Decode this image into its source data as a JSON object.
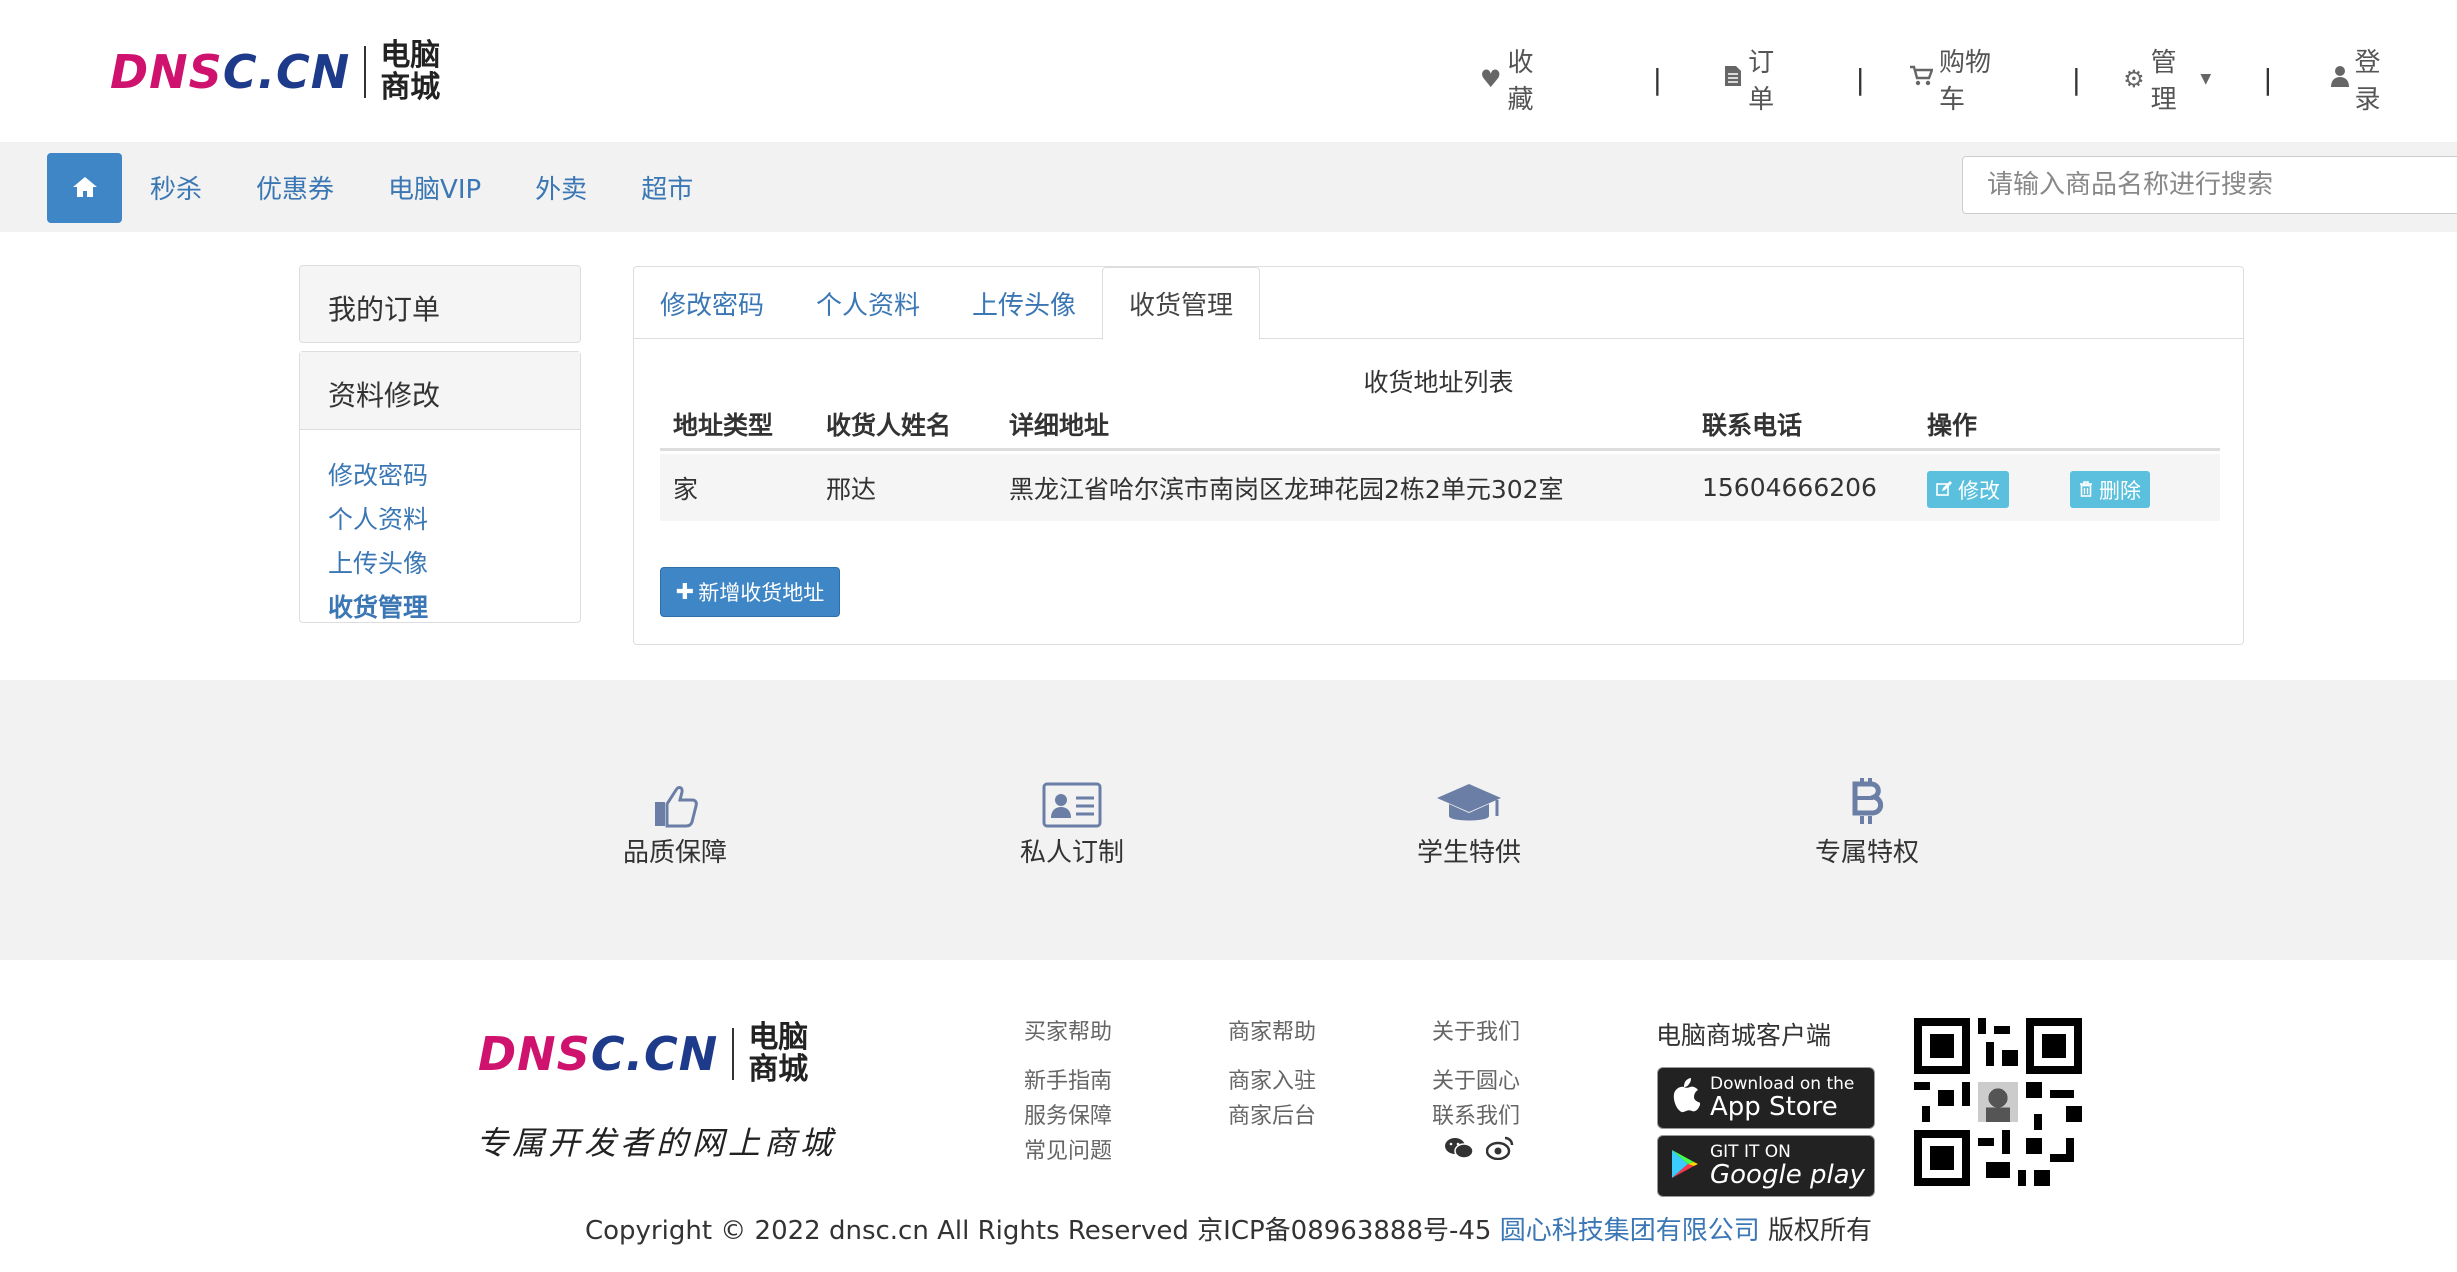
{
  "brand": {
    "logo_en": "DNSC.CN",
    "logo_cn_line1": "电脑",
    "logo_cn_line2": "商城",
    "colors": {
      "magenta": "#d0126f",
      "navy": "#1e3a8a",
      "primary": "#3f86c6",
      "info": "#5bc0de",
      "link": "#3a77b4"
    }
  },
  "topnav": {
    "favorites": "收藏",
    "orders": "订单",
    "cart": "购物车",
    "manage": "管理",
    "login": "登录",
    "separator": "|"
  },
  "navbar": {
    "home_icon": "home-icon",
    "links": [
      "秒杀",
      "优惠券",
      "电脑VIP",
      "外卖",
      "超市"
    ],
    "search_placeholder": "请输入商品名称进行搜索"
  },
  "sidebar": {
    "my_orders": "我的订单",
    "profile_edit": "资料修改",
    "links": [
      "修改密码",
      "个人资料",
      "上传头像",
      "收货管理"
    ],
    "active_index": 3
  },
  "main": {
    "tabs": [
      "修改密码",
      "个人资料",
      "上传头像",
      "收货管理"
    ],
    "active_tab": 3,
    "table_caption": "收货地址列表",
    "columns": [
      "地址类型",
      "收货人姓名",
      "详细地址",
      "联系电话",
      "操作"
    ],
    "rows": [
      {
        "type": "家",
        "name": "邢达",
        "address": "黑龙江省哈尔滨市南岗区龙珅花园2栋2单元302室",
        "phone": "15604666206",
        "edit": "修改",
        "delete": "删除"
      }
    ],
    "add_button": "新增收货地址"
  },
  "features": [
    {
      "label": "品质保障",
      "icon": "thumbs-up-icon"
    },
    {
      "label": "私人订制",
      "icon": "id-card-icon"
    },
    {
      "label": "学生特供",
      "icon": "graduation-cap-icon"
    },
    {
      "label": "专属特权",
      "icon": "bitcoin-icon"
    }
  ],
  "footer": {
    "slogan": "专属开发者的网上商城",
    "buyer_help": {
      "title": "买家帮助",
      "links": [
        "新手指南",
        "服务保障",
        "常见问题"
      ]
    },
    "merchant_help": {
      "title": "商家帮助",
      "links": [
        "商家入驻",
        "商家后台"
      ]
    },
    "about": {
      "title": "关于我们",
      "links": [
        "关于圆心",
        "联系我们"
      ]
    },
    "client_title": "电脑商城客户端",
    "app_store_small": "Download on the",
    "app_store_big": "App Store",
    "google_small": "GIT IT ON",
    "google_big": "Google play",
    "copyright_prefix": "Copyright © 2022 dnsc.cn All Rights Reserved 京ICP备08963888号-45",
    "company_link": "圆心科技集团有限公司",
    "copyright_suffix": "版权所有"
  }
}
